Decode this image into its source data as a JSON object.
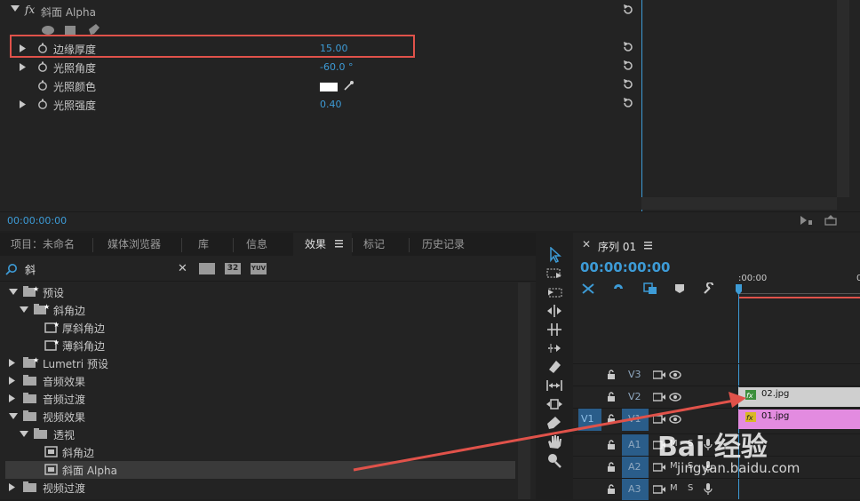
{
  "effect_controls": {
    "effect_name": "斜面 Alpha",
    "fx_label": "fx",
    "properties": [
      {
        "name": "边缘厚度",
        "value": "15.00"
      },
      {
        "name": "光照角度",
        "value": "-60.0 °"
      },
      {
        "name": "光照颜色",
        "value": ""
      },
      {
        "name": "光照强度",
        "value": "0.40"
      }
    ],
    "timecode": "00:00:00:00"
  },
  "project_panel": {
    "tabs": [
      "项目：未命名",
      "媒体浏览器",
      "库",
      "信息",
      "效果",
      "标记",
      "历史记录"
    ],
    "active_tab": "效果",
    "search_value": "斜",
    "filter_badges": [
      "32",
      "YUV"
    ],
    "tree": [
      {
        "label": "预设"
      },
      {
        "label": "斜角边"
      },
      {
        "label": "厚斜角边"
      },
      {
        "label": "薄斜角边"
      },
      {
        "label": "Lumetri 预设"
      },
      {
        "label": "音频效果"
      },
      {
        "label": "音频过渡"
      },
      {
        "label": "视频效果"
      },
      {
        "label": "透视"
      },
      {
        "label": "斜角边"
      },
      {
        "label": "斜面 Alpha"
      },
      {
        "label": "视频过渡"
      }
    ]
  },
  "timeline": {
    "sequence_tab": "序列 01",
    "timecode": "00:00:00:00",
    "ruler_start": ":00:00",
    "tracks": [
      {
        "name": "V3"
      },
      {
        "name": "V2",
        "clip": "02.jpg"
      },
      {
        "name": "V1",
        "source": "V1",
        "clip": "01.jpg"
      },
      {
        "name": "A1",
        "m": "M",
        "s": "S"
      },
      {
        "name": "A2",
        "m": "M",
        "s": "S"
      },
      {
        "name": "A3",
        "m": "M",
        "s": "S"
      }
    ]
  },
  "watermark": {
    "text": "Bai 经验",
    "url": "jingyan.baidu.com"
  },
  "colors": {
    "accent_blue": "#3d9bd6",
    "highlight_red": "#e0524a",
    "clip_v2": "#cfcfcf",
    "clip_v1": "#e38be0"
  }
}
